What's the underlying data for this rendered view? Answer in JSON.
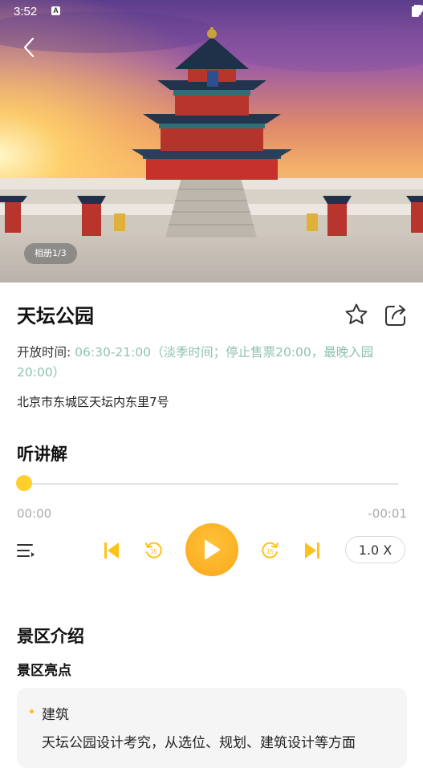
{
  "status_bar": {
    "time": "3:52",
    "notification_glyph": "A"
  },
  "hero": {
    "album_label": "相册1/3"
  },
  "attraction": {
    "name": "天坛公园",
    "hours_label": "开放时间:",
    "hours_value": "06:30-21:00（淡季时间；停止售票20:00，最晚入园20:00）",
    "address": "北京市东城区天坛内东里7号"
  },
  "audio": {
    "section_title": "听讲解",
    "progress": 0,
    "time_current": "00:00",
    "time_remaining": "-00:01",
    "rewind_seconds": "15",
    "forward_seconds": "15",
    "speed_label": "1.0 X"
  },
  "intro": {
    "section_title": "景区介绍",
    "highlights_title": "景区亮点",
    "card_title": "建筑",
    "card_text": "天坛公园设计考究，从选位、规划、建筑设计等方面"
  },
  "colors": {
    "accent": "#ffc21a",
    "play": "#f9a81a",
    "hours_value": "#8dc3ae"
  },
  "icons": [
    "back-icon",
    "star-icon",
    "share-icon",
    "playlist-icon",
    "skip-previous-icon",
    "rewind-15-icon",
    "play-icon",
    "forward-15-icon",
    "skip-next-icon"
  ]
}
